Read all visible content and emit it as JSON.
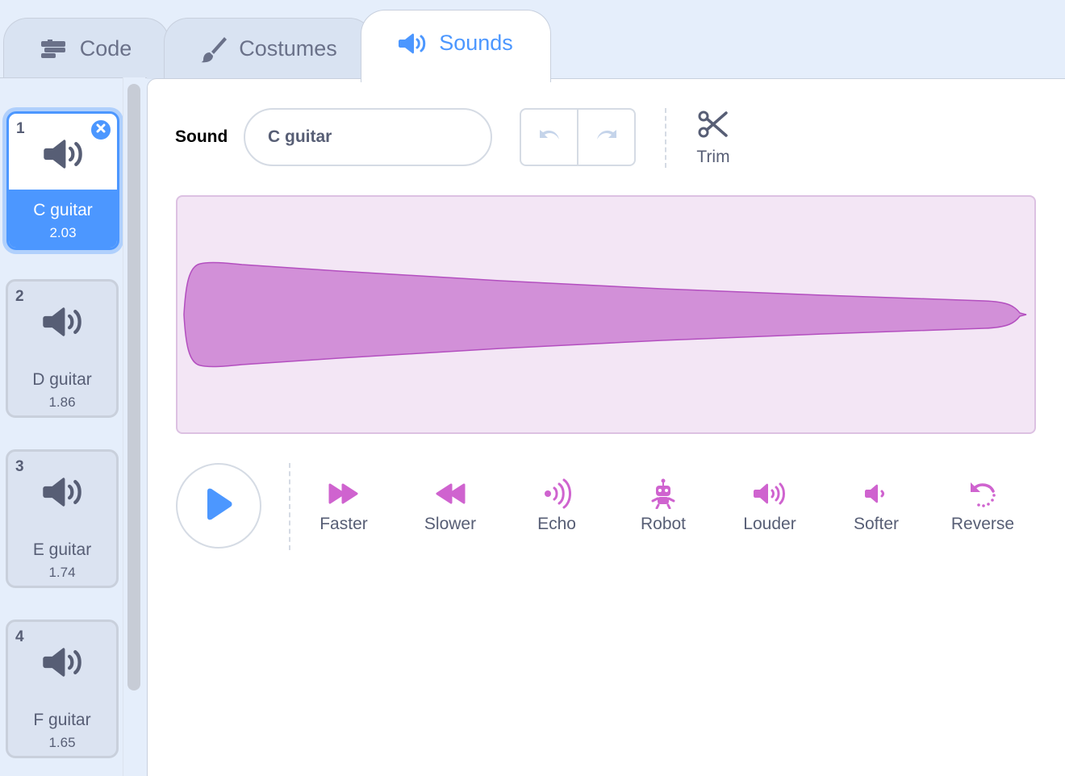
{
  "tabs": [
    {
      "label": "Code",
      "icon": "code-blocks-icon"
    },
    {
      "label": "Costumes",
      "icon": "paintbrush-icon"
    },
    {
      "label": "Sounds",
      "icon": "speaker-icon",
      "active": true
    }
  ],
  "sound_list": [
    {
      "number": "1",
      "name": "C guitar",
      "duration": "2.03",
      "selected": true
    },
    {
      "number": "2",
      "name": "D guitar",
      "duration": "1.86"
    },
    {
      "number": "3",
      "name": "E guitar",
      "duration": "1.74"
    },
    {
      "number": "4",
      "name": "F guitar",
      "duration": "1.65"
    }
  ],
  "editor": {
    "sound_label": "Sound",
    "sound_name": "C guitar",
    "trim_label": "Trim"
  },
  "effects": [
    {
      "label": "Faster",
      "icon": "faster-icon"
    },
    {
      "label": "Slower",
      "icon": "slower-icon"
    },
    {
      "label": "Echo",
      "icon": "echo-icon"
    },
    {
      "label": "Robot",
      "icon": "robot-icon"
    },
    {
      "label": "Louder",
      "icon": "louder-icon"
    },
    {
      "label": "Softer",
      "icon": "softer-icon"
    },
    {
      "label": "Reverse",
      "icon": "reverse-icon"
    }
  ],
  "colors": {
    "accent": "#4c97ff",
    "sound_purple": "#cf63cf",
    "waveform_fill": "#d290d8",
    "waveform_bg": "#f3e6f5"
  }
}
